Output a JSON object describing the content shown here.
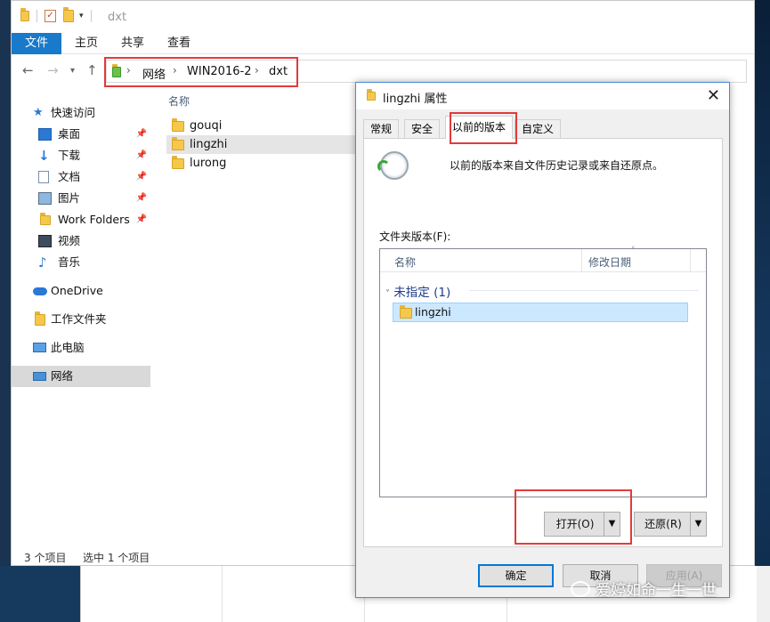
{
  "window": {
    "title": "dxt"
  },
  "ribbon": {
    "tabs": [
      "文件",
      "主页",
      "共享",
      "查看"
    ]
  },
  "address": {
    "crumbs": [
      "网络",
      "WIN2016-2",
      "dxt"
    ]
  },
  "sidebar": {
    "items": [
      {
        "label": "快速访问",
        "icon": "star-icon",
        "pinned": false
      },
      {
        "label": "桌面",
        "icon": "desktop-icon",
        "pinned": true
      },
      {
        "label": "下载",
        "icon": "download-icon",
        "pinned": true
      },
      {
        "label": "文档",
        "icon": "document-icon",
        "pinned": true
      },
      {
        "label": "图片",
        "icon": "picture-icon",
        "pinned": true
      },
      {
        "label": "Work Folders",
        "icon": "folder-icon",
        "pinned": true
      },
      {
        "label": "视频",
        "icon": "video-icon",
        "pinned": false
      },
      {
        "label": "音乐",
        "icon": "music-icon",
        "pinned": false
      },
      {
        "label": "OneDrive",
        "icon": "cloud-icon",
        "pinned": false
      },
      {
        "label": "工作文件夹",
        "icon": "work-folder-icon",
        "pinned": false
      },
      {
        "label": "此电脑",
        "icon": "computer-icon",
        "pinned": false
      },
      {
        "label": "网络",
        "icon": "network-icon",
        "pinned": false
      }
    ]
  },
  "content": {
    "column_header": "名称",
    "items": [
      "gouqi",
      "lingzhi",
      "lurong"
    ],
    "selected": "lingzhi"
  },
  "status": {
    "count": "3 个项目",
    "selection": "选中 1 个项目"
  },
  "dialog": {
    "title": "lingzhi 属性",
    "tabs": [
      "常规",
      "安全",
      "以前的版本",
      "自定义"
    ],
    "active_tab": "以前的版本",
    "description": "以前的版本来自文件历史记录或来自还原点。",
    "versions_label": "文件夹版本(F):",
    "columns": [
      "名称",
      "修改日期"
    ],
    "group_label": "未指定 (1)",
    "version_rows": [
      "lingzhi"
    ],
    "open_label": "打开(O)",
    "restore_label": "还原(R)",
    "ok_label": "确定",
    "cancel_label": "取消",
    "apply_label": "应用(A)"
  },
  "watermark": {
    "text": "爱婷如命一生一世"
  },
  "colors": {
    "accent": "#1979ca",
    "highlight": "#e23b3b",
    "selection": "#cce8ff"
  }
}
